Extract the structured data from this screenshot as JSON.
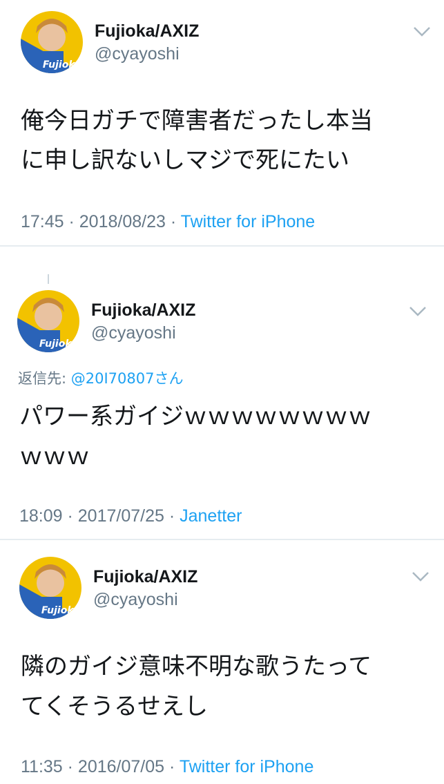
{
  "colors": {
    "link": "#1da1f2",
    "secondary_text": "#657786",
    "primary_text": "#14171a",
    "divider": "#e6ecf0"
  },
  "tweets": [
    {
      "display_name": "Fujioka/AXIZ",
      "handle": "@cyayoshi",
      "avatar_caption": "Fujioka",
      "menu_icon": "chevron-down-icon",
      "lines": [
        "俺今日ガチで障害者だったし本当",
        "に申し訳ないしマジで死にたい"
      ],
      "timestamp": "17:45 · 2018/08/23 · ",
      "source": "Twitter for iPhone"
    },
    {
      "display_name": "Fujioka/AXIZ",
      "handle": "@cyayoshi",
      "avatar_caption": "Fujioka",
      "menu_icon": "chevron-down-icon",
      "reply_prefix": "返信先: ",
      "reply_mention": "@20I70807さん",
      "lines": [
        "パワー系ガイジｗｗｗｗｗｗｗｗ",
        "ｗｗｗ"
      ],
      "timestamp": "18:09 · 2017/07/25 · ",
      "source": "Janetter"
    },
    {
      "display_name": "Fujioka/AXIZ",
      "handle": "@cyayoshi",
      "avatar_caption": "Fujioka",
      "menu_icon": "chevron-down-icon",
      "lines": [
        "隣のガイジ意味不明な歌うたって",
        "てくそうるせえし"
      ],
      "timestamp": "11:35 · 2016/07/05 · ",
      "source": "Twitter for iPhone"
    }
  ]
}
